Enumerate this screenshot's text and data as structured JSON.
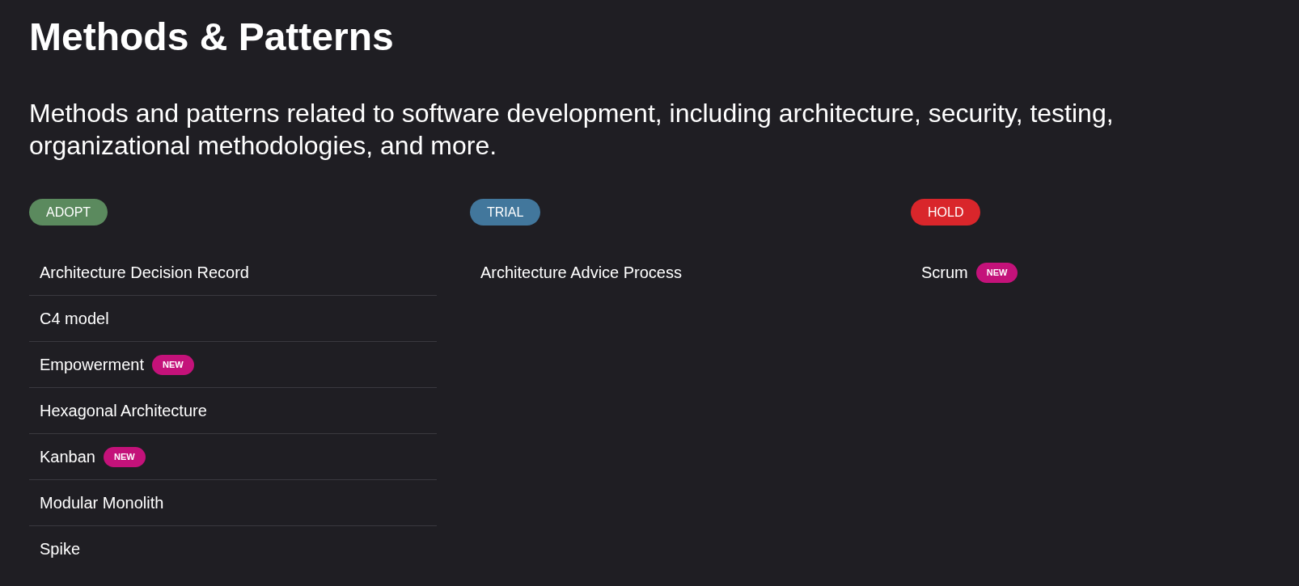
{
  "title": "Methods & Patterns",
  "description": "Methods and patterns related to software development, including architecture, security, testing, organizational methodologies, and more.",
  "rings": [
    {
      "label": "ADOPT",
      "color": "#5b8a5e",
      "items": [
        {
          "name": "Architecture Decision Record"
        },
        {
          "name": "C4 model"
        },
        {
          "name": "Empowerment",
          "badge": "NEW"
        },
        {
          "name": "Hexagonal Architecture"
        },
        {
          "name": "Kanban",
          "badge": "NEW"
        },
        {
          "name": "Modular Monolith"
        },
        {
          "name": "Spike"
        }
      ]
    },
    {
      "label": "TRIAL",
      "color": "#42779c",
      "items": [
        {
          "name": "Architecture Advice Process"
        }
      ]
    },
    {
      "label": "HOLD",
      "color": "#d9262b",
      "items": [
        {
          "name": "Scrum",
          "badge": "NEW"
        }
      ]
    }
  ]
}
